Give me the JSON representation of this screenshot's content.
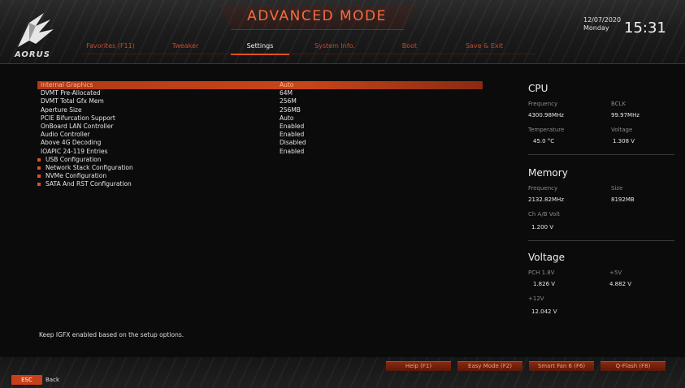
{
  "header": {
    "mode_title": "ADVANCED MODE",
    "brand": "AORUS",
    "tabs": [
      {
        "label": "Favorites (F11)",
        "active": false
      },
      {
        "label": "Tweaker",
        "active": false
      },
      {
        "label": "Settings",
        "active": true
      },
      {
        "label": "System Info.",
        "active": false
      },
      {
        "label": "Boot",
        "active": false
      },
      {
        "label": "Save & Exit",
        "active": false
      }
    ],
    "date": "12/07/2020",
    "day": "Monday",
    "time": "15:31"
  },
  "settings": {
    "items": [
      {
        "label": "Internal Graphics",
        "value": "Auto",
        "selected": true,
        "submenu": false
      },
      {
        "label": "DVMT Pre-Allocated",
        "value": "64M",
        "selected": false,
        "submenu": false
      },
      {
        "label": "DVMT Total Gfx Mem",
        "value": "256M",
        "selected": false,
        "submenu": false
      },
      {
        "label": "Aperture Size",
        "value": "256MB",
        "selected": false,
        "submenu": false
      },
      {
        "label": "PCIE Bifurcation Support",
        "value": "Auto",
        "selected": false,
        "submenu": false
      },
      {
        "label": "OnBoard LAN Controller",
        "value": "Enabled",
        "selected": false,
        "submenu": false
      },
      {
        "label": "Audio Controller",
        "value": "Enabled",
        "selected": false,
        "submenu": false
      },
      {
        "label": "Above 4G Decoding",
        "value": "Disabled",
        "selected": false,
        "submenu": false
      },
      {
        "label": "IOAPIC 24-119 Entries",
        "value": "Enabled",
        "selected": false,
        "submenu": false
      },
      {
        "label": "USB Configuration",
        "value": "",
        "selected": false,
        "submenu": true
      },
      {
        "label": "Network Stack Configuration",
        "value": "",
        "selected": false,
        "submenu": true
      },
      {
        "label": "NVMe Configuration",
        "value": "",
        "selected": false,
        "submenu": true
      },
      {
        "label": "SATA And RST Configuration",
        "value": "",
        "selected": false,
        "submenu": true
      }
    ],
    "help_text": "Keep IGFX enabled based on the setup options."
  },
  "cpu": {
    "title": "CPU",
    "freq_label": "Frequency",
    "freq_value": "4300.98MHz",
    "bclk_label": "BCLK",
    "bclk_value": "99.97MHz",
    "temp_label": "Temperature",
    "temp_value": "45.0 °C",
    "volt_label": "Voltage",
    "volt_value": "1.308 V"
  },
  "memory": {
    "title": "Memory",
    "freq_label": "Frequency",
    "freq_value": "2132.82MHz",
    "size_label": "Size",
    "size_value": "8192MB",
    "volt_label": "Ch A/B Volt",
    "volt_value": "1.200 V"
  },
  "voltage": {
    "title": "Voltage",
    "pch_label": "PCH 1.8V",
    "pch_value": "1.826 V",
    "v5_label": "+5V",
    "v5_value": "4.882 V",
    "v12_label": "+12V",
    "v12_value": "12.042 V"
  },
  "footer": {
    "buttons": [
      {
        "label": "Help (F1)"
      },
      {
        "label": "Easy Mode (F2)"
      },
      {
        "label": "Smart Fan 6 (F6)"
      },
      {
        "label": "Q-Flash (F8)"
      }
    ],
    "esc_label": "ESC",
    "back_label": "Back"
  },
  "colors": {
    "accent": "#e0521e",
    "selected_row": "#c8451a",
    "title": "#ff6a3a"
  }
}
